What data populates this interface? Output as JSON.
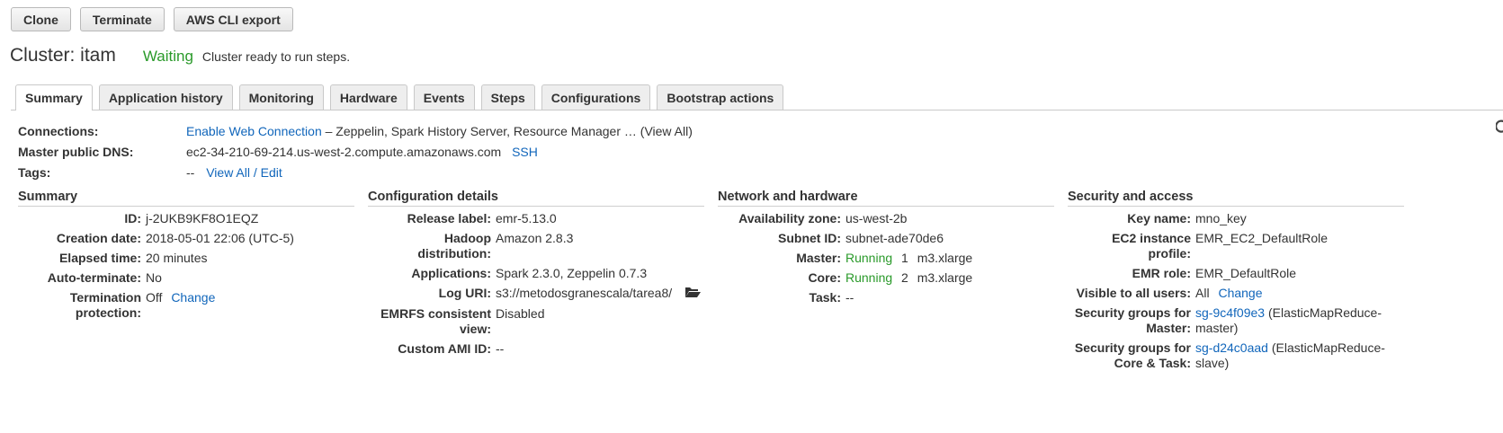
{
  "toolbar": {
    "clone": "Clone",
    "terminate": "Terminate",
    "aws_cli": "AWS CLI export"
  },
  "cluster": {
    "title": "Cluster: itam",
    "status": "Waiting",
    "status_msg": "Cluster ready to run steps."
  },
  "tabs": [
    "Summary",
    "Application history",
    "Monitoring",
    "Hardware",
    "Events",
    "Steps",
    "Configurations",
    "Bootstrap actions"
  ],
  "connections": {
    "label": "Connections:",
    "link": "Enable Web Connection",
    "text": "– Zeppelin, Spark History Server, Resource Manager … (View All)"
  },
  "dns": {
    "label": "Master public DNS:",
    "value": "ec2-34-210-69-214.us-west-2.compute.amazonaws.com",
    "ssh": "SSH"
  },
  "tags": {
    "label": "Tags:",
    "value": "--",
    "link": "View All / Edit"
  },
  "summary": {
    "title": "Summary",
    "id_label": "ID:",
    "id": "j-2UKB9KF8O1EQZ",
    "creation_label": "Creation date:",
    "creation": "2018-05-01 22:06 (UTC-5)",
    "elapsed_label": "Elapsed time:",
    "elapsed": "20 minutes",
    "auto_label": "Auto-terminate:",
    "auto": "No",
    "term_label_1": "Termination",
    "term_label_2": "protection:",
    "term": "Off",
    "term_change": "Change"
  },
  "config": {
    "title": "Configuration details",
    "release_label": "Release label:",
    "release": "emr-5.13.0",
    "hadoop_label": "Hadoop distribution:",
    "hadoop": "Amazon 2.8.3",
    "apps_label": "Applications:",
    "apps": "Spark 2.3.0, Zeppelin 0.7.3",
    "log_label": "Log URI:",
    "log": "s3://metodosgranescala/tarea8/",
    "emrfs_label_1": "EMRFS consistent",
    "emrfs_label_2": "view:",
    "emrfs": "Disabled",
    "ami_label": "Custom AMI ID:",
    "ami": "--"
  },
  "network": {
    "title": "Network and hardware",
    "az_label": "Availability zone:",
    "az": "us-west-2b",
    "subnet_label": "Subnet ID:",
    "subnet": "subnet-ade70de6",
    "master_label": "Master:",
    "master_status": "Running",
    "master_count": "1",
    "master_type": "m3.xlarge",
    "core_label": "Core:",
    "core_status": "Running",
    "core_count": "2",
    "core_type": "m3.xlarge",
    "task_label": "Task:",
    "task": "--"
  },
  "security": {
    "title": "Security and access",
    "key_label": "Key name:",
    "key": "mno_key",
    "ec2_label": "EC2 instance profile:",
    "ec2": "EMR_EC2_DefaultRole",
    "role_label": "EMR role:",
    "role": "EMR_DefaultRole",
    "visible_label": "Visible to all users:",
    "visible": "All",
    "visible_change": "Change",
    "sg_master_label_1": "Security groups for",
    "sg_master_label_2": "Master:",
    "sg_master_link": "sg-9c4f09e3",
    "sg_master_text_1": "(ElasticMapReduce-",
    "sg_master_text_2": "master)",
    "sg_core_label_1": "Security groups for",
    "sg_core_label_2": "Core & Task:",
    "sg_core_link": "sg-d24c0aad",
    "sg_core_text_1": "(ElasticMapReduce-",
    "sg_core_text_2": "slave)"
  },
  "colors": {
    "link": "#1166bb",
    "running": "#2a9a2a",
    "waiting": "#2a9a2a"
  }
}
